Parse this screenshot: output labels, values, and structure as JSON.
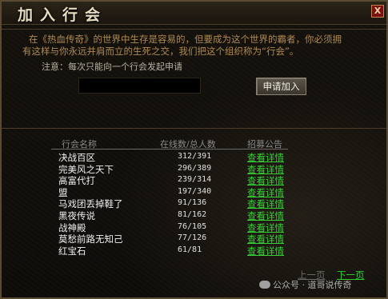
{
  "window": {
    "title": "加入行会",
    "close": "X"
  },
  "intro": {
    "line1": "在《热血传奇》的世界中生存是容易的，但要成为这个世界的霸者，你必须拥",
    "line2": "有这样与你永远并肩而立的生死之交，我们把这个组织称为“行会”。",
    "note": "注意：每次只能向一个行会发起申请"
  },
  "guild_name_input": {
    "value": ""
  },
  "apply_button": "申请加入",
  "table": {
    "headers": {
      "name": "行会名称",
      "online": "在线数/总人数",
      "recruit": "招募公告"
    },
    "rows": [
      {
        "name": "决战百区",
        "count": "312/391",
        "link": "查看详情"
      },
      {
        "name": "完美风之天下",
        "count": "296/389",
        "link": "查看详情"
      },
      {
        "name": "高富代打",
        "count": "239/314",
        "link": "查看详情"
      },
      {
        "name": "盟",
        "count": "197/340",
        "link": "查看详情"
      },
      {
        "name": "马戏团丢掉鞋了",
        "count": "91/136",
        "link": "查看详情"
      },
      {
        "name": "黑夜传说",
        "count": "81/162",
        "link": "查看详情"
      },
      {
        "name": "战神殿",
        "count": "76/105",
        "link": "查看详情"
      },
      {
        "name": "莫愁前路无知己",
        "count": "77/126",
        "link": "查看详情"
      },
      {
        "name": "红宝石",
        "count": "61/81",
        "link": "查看详情"
      }
    ]
  },
  "pagination": {
    "prev": "上一页",
    "next": "下一页"
  },
  "watermark": "公众号 · 道哥说传奇",
  "colors": {
    "link_green": "#36d236",
    "intro_text": "#b08a50",
    "background": "#0d0b08"
  }
}
